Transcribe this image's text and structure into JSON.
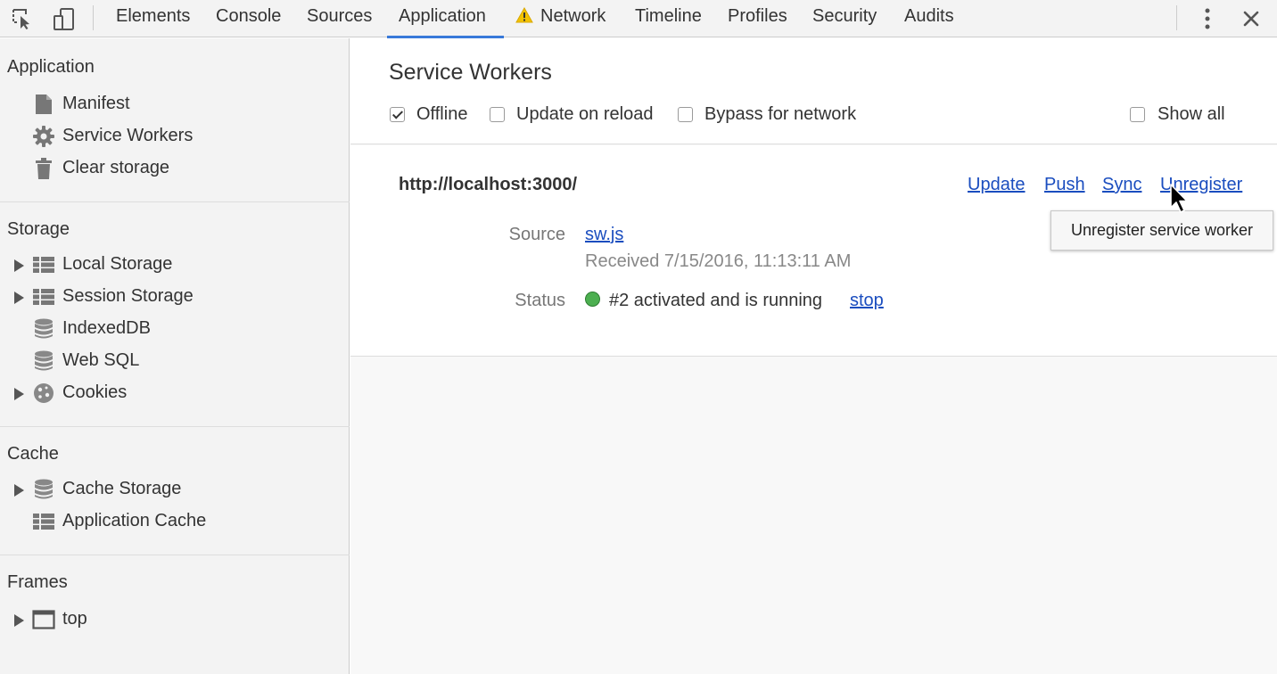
{
  "toolbar": {
    "tabs": [
      {
        "label": "Elements"
      },
      {
        "label": "Console"
      },
      {
        "label": "Sources"
      },
      {
        "label": "Application",
        "active": true
      },
      {
        "label": "Network",
        "warning": true
      },
      {
        "label": "Timeline"
      },
      {
        "label": "Profiles"
      },
      {
        "label": "Security"
      },
      {
        "label": "Audits"
      }
    ],
    "icons": [
      "inspect-element-icon",
      "device-mode-icon",
      "more-options-icon",
      "close-icon"
    ]
  },
  "sidebar": {
    "sections": [
      {
        "header": "Application",
        "items": [
          {
            "label": "Manifest",
            "icon": "document-icon"
          },
          {
            "label": "Service Workers",
            "icon": "gear-icon"
          },
          {
            "label": "Clear storage",
            "icon": "trash-icon"
          }
        ]
      },
      {
        "header": "Storage",
        "items": [
          {
            "label": "Local Storage",
            "icon": "grid-icon",
            "expandable": true
          },
          {
            "label": "Session Storage",
            "icon": "grid-icon",
            "expandable": true
          },
          {
            "label": "IndexedDB",
            "icon": "database-icon"
          },
          {
            "label": "Web SQL",
            "icon": "database-icon"
          },
          {
            "label": "Cookies",
            "icon": "cookie-icon",
            "expandable": true
          }
        ]
      },
      {
        "header": "Cache",
        "items": [
          {
            "label": "Cache Storage",
            "icon": "database-icon",
            "expandable": true
          },
          {
            "label": "Application Cache",
            "icon": "grid-icon"
          }
        ]
      },
      {
        "header": "Frames",
        "items": [
          {
            "label": "top",
            "icon": "frame-icon",
            "expandable": true
          }
        ]
      }
    ]
  },
  "main": {
    "title": "Service Workers",
    "options": [
      {
        "label": "Offline",
        "checked": true
      },
      {
        "label": "Update on reload",
        "checked": false
      },
      {
        "label": "Bypass for network",
        "checked": false
      },
      {
        "label": "Show all",
        "checked": false
      }
    ],
    "worker": {
      "origin": "http://localhost:3000/",
      "actions": [
        "Update",
        "Push",
        "Sync",
        "Unregister"
      ],
      "source_label": "Source",
      "source_file": "sw.js",
      "received": "Received 7/15/2016, 11:13:11 AM",
      "status_label": "Status",
      "status_text": "#2 activated and is running",
      "status_color": "#4caf50",
      "stop_label": "stop"
    },
    "tooltip": "Unregister service worker"
  },
  "colors": {
    "accent": "#3879d9",
    "link": "#1a4dbf",
    "warning": "#f2c200"
  }
}
